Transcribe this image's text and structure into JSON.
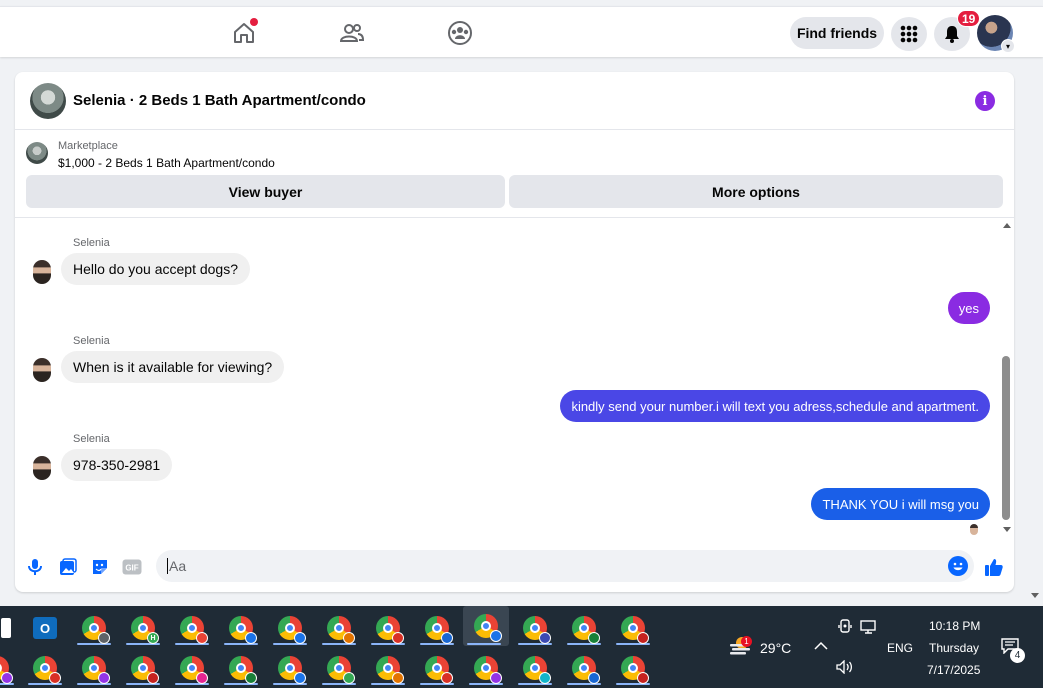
{
  "topbar": {
    "find_friends_label": "Find friends",
    "notification_count": "19"
  },
  "chat": {
    "title": "Selenia · 2 Beds 1 Bath Apartment/condo",
    "marketplace_label": "Marketplace",
    "listing": "$1,000 - 2 Beds 1 Bath Apartment/condo",
    "view_buyer_label": "View buyer",
    "more_options_label": "More options",
    "messages": [
      {
        "sender": "Selenia",
        "text": "Hello do you accept dogs?"
      },
      {
        "text": "yes"
      },
      {
        "sender": "Selenia",
        "text": "When is it available for viewing?"
      },
      {
        "text": "kindly send your number.i will text you adress,schedule and apartment."
      },
      {
        "sender": "Selenia",
        "text": "978-350-2981"
      },
      {
        "text": "THANK YOU i will msg you"
      }
    ],
    "composer_placeholder": "Aa",
    "gif_label": "GIF"
  },
  "colors": {
    "accent": "#0866ff",
    "out_yes": "#8a2be2",
    "out_number": "#4a47e6",
    "out_thanks": "#1a5fe8",
    "info": "#8a2be2"
  },
  "taskbar": {
    "temperature": "29°C",
    "language": "ENG",
    "time": "10:18 PM",
    "day": "Thursday",
    "date": "7/17/2025",
    "weather_alert_count": "1",
    "notification_count": "4",
    "outlook_letter": "O",
    "profile_letter": "H"
  }
}
